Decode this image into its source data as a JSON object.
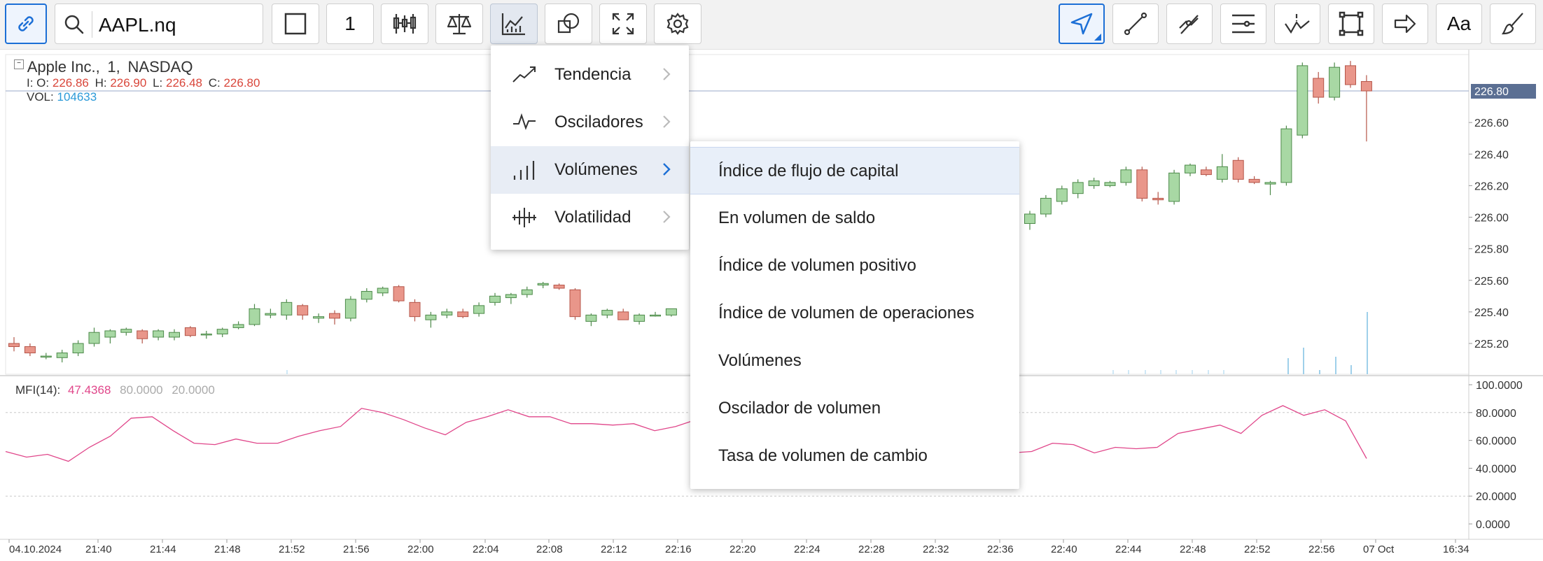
{
  "toolbar": {
    "symbol": "AAPL.nq",
    "interval": "1",
    "text_tool": "Aa"
  },
  "legend": {
    "title": "Apple Inc.,",
    "interval": "1,",
    "exchange": "NASDAQ",
    "o_label": "I: O:",
    "o": "226.86",
    "h_label": "H:",
    "h": "226.90",
    "l_label": "L:",
    "l": "226.48",
    "c_label": "C:",
    "c": "226.80",
    "vol_label": "VOL:",
    "vol": "104633"
  },
  "price_axis": {
    "ticks": [
      "226.60",
      "226.40",
      "226.20",
      "226.00",
      "225.80",
      "225.60",
      "225.40",
      "225.20"
    ],
    "current": "226.80"
  },
  "mfi": {
    "label": "MFI(14):",
    "value": "47.4368",
    "upper": "80.0000",
    "lower": "20.0000",
    "ticks": [
      "100.0000",
      "80.0000",
      "60.0000",
      "40.0000",
      "20.0000",
      "0.0000"
    ]
  },
  "time_axis": [
    "04.10.2024",
    "21:40",
    "21:44",
    "21:48",
    "21:52",
    "21:56",
    "22:00",
    "22:04",
    "22:08",
    "22:12",
    "22:16",
    "22:20",
    "22:24",
    "22:28",
    "22:32",
    "22:36",
    "22:40",
    "22:44",
    "22:48",
    "22:52",
    "22:56",
    "07 Oct",
    "16:34"
  ],
  "menu": {
    "items": [
      {
        "label": "Tendencia",
        "icon": "trend-icon"
      },
      {
        "label": "Osciladores",
        "icon": "oscillator-icon"
      },
      {
        "label": "Volúmenes",
        "icon": "volume-icon"
      },
      {
        "label": "Volatilidad",
        "icon": "volatility-icon"
      }
    ],
    "selected": "Volúmenes"
  },
  "submenu": {
    "items": [
      "Índice de flujo de capital",
      "En volumen de saldo",
      "Índice de volumen positivo",
      "Índice de volumen de operaciones",
      "Volúmenes",
      "Oscilador de volumen",
      "Tasa de volumen de cambio"
    ],
    "selected": "Índice de flujo de capital"
  },
  "colors": {
    "up": "#a8d8a4",
    "down": "#e9968a",
    "accent": "#1c6fd6",
    "mfi_line": "#e0468a",
    "current_price_bg": "#5b6f93"
  },
  "chart_data": {
    "type": "candlestick",
    "price_ylim": [
      225.0,
      226.9
    ],
    "mfi_ylim": [
      0,
      100
    ],
    "candles_visible_left": [
      [
        225.2,
        225.24,
        225.15,
        225.18
      ],
      [
        225.18,
        225.2,
        225.12,
        225.14
      ],
      [
        225.12,
        225.14,
        225.1,
        225.12
      ],
      [
        225.11,
        225.16,
        225.08,
        225.14
      ],
      [
        225.14,
        225.22,
        225.12,
        225.2
      ],
      [
        225.2,
        225.3,
        225.18,
        225.27
      ],
      [
        225.24,
        225.29,
        225.2,
        225.28
      ],
      [
        225.27,
        225.3,
        225.25,
        225.29
      ],
      [
        225.28,
        225.29,
        225.2,
        225.23
      ],
      [
        225.24,
        225.29,
        225.22,
        225.28
      ],
      [
        225.24,
        225.29,
        225.22,
        225.27
      ],
      [
        225.3,
        225.31,
        225.24,
        225.25
      ],
      [
        225.26,
        225.28,
        225.23,
        225.26
      ],
      [
        225.26,
        225.3,
        225.24,
        225.29
      ],
      [
        225.3,
        225.34,
        225.29,
        225.32
      ],
      [
        225.32,
        225.45,
        225.31,
        225.42
      ],
      [
        225.38,
        225.42,
        225.36,
        225.39
      ],
      [
        225.38,
        225.48,
        225.35,
        225.46
      ],
      [
        225.44,
        225.45,
        225.35,
        225.38
      ],
      [
        225.36,
        225.39,
        225.33,
        225.37
      ],
      [
        225.39,
        225.41,
        225.32,
        225.36
      ],
      [
        225.36,
        225.5,
        225.34,
        225.48
      ],
      [
        225.48,
        225.55,
        225.46,
        225.53
      ],
      [
        225.52,
        225.56,
        225.5,
        225.55
      ],
      [
        225.56,
        225.57,
        225.46,
        225.47
      ],
      [
        225.46,
        225.48,
        225.34,
        225.37
      ],
      [
        225.35,
        225.4,
        225.3,
        225.38
      ],
      [
        225.38,
        225.42,
        225.36,
        225.4
      ],
      [
        225.4,
        225.42,
        225.36,
        225.37
      ],
      [
        225.39,
        225.46,
        225.37,
        225.44
      ],
      [
        225.46,
        225.52,
        225.44,
        225.5
      ],
      [
        225.49,
        225.52,
        225.45,
        225.51
      ],
      [
        225.51,
        225.56,
        225.49,
        225.54
      ],
      [
        225.57,
        225.59,
        225.55,
        225.58
      ],
      [
        225.57,
        225.58,
        225.54,
        225.55
      ],
      [
        225.54,
        225.55,
        225.35,
        225.37
      ],
      [
        225.34,
        225.39,
        225.31,
        225.38
      ],
      [
        225.38,
        225.42,
        225.36,
        225.41
      ],
      [
        225.4,
        225.42,
        225.35,
        225.35
      ],
      [
        225.34,
        225.39,
        225.32,
        225.38
      ],
      [
        225.38,
        225.4,
        225.37,
        225.38
      ],
      [
        225.38,
        225.42,
        225.37,
        225.42
      ]
    ],
    "candles_visible_right": [
      [
        225.96,
        226.04,
        225.92,
        226.02
      ],
      [
        226.02,
        226.14,
        226.0,
        226.12
      ],
      [
        226.1,
        226.2,
        226.08,
        226.18
      ],
      [
        226.15,
        226.24,
        226.12,
        226.22
      ],
      [
        226.2,
        226.25,
        226.18,
        226.23
      ],
      [
        226.2,
        226.23,
        226.19,
        226.22
      ],
      [
        226.22,
        226.32,
        226.2,
        226.3
      ],
      [
        226.3,
        226.32,
        226.1,
        226.12
      ],
      [
        226.12,
        226.16,
        226.08,
        226.11
      ],
      [
        226.1,
        226.3,
        226.08,
        226.28
      ],
      [
        226.28,
        226.34,
        226.26,
        226.33
      ],
      [
        226.3,
        226.32,
        226.26,
        226.27
      ],
      [
        226.24,
        226.4,
        226.22,
        226.32
      ],
      [
        226.36,
        226.38,
        226.22,
        226.24
      ],
      [
        226.24,
        226.26,
        226.21,
        226.22
      ],
      [
        226.21,
        226.23,
        226.14,
        226.22
      ],
      [
        226.22,
        226.58,
        226.2,
        226.56
      ],
      [
        226.52,
        226.98,
        226.5,
        226.96
      ],
      [
        226.88,
        226.92,
        226.72,
        226.76
      ],
      [
        226.76,
        226.98,
        226.74,
        226.95
      ],
      [
        226.96,
        226.99,
        226.82,
        226.84
      ],
      [
        226.86,
        226.9,
        226.48,
        226.8
      ]
    ],
    "mfi_series": [
      52,
      48,
      50,
      45,
      55,
      63,
      76,
      77,
      67,
      58,
      57,
      61,
      58,
      58,
      63,
      67,
      70,
      83,
      80,
      75,
      69,
      64,
      73,
      77,
      82,
      77,
      77,
      72,
      72,
      71,
      72,
      67,
      70,
      75,
      81,
      78,
      68,
      66,
      66,
      67,
      73,
      71,
      62,
      58,
      55,
      52,
      55,
      55,
      51,
      52,
      58,
      57,
      51,
      55,
      54,
      55,
      65,
      68,
      71,
      65,
      78,
      85,
      78,
      82,
      74,
      47
    ]
  }
}
